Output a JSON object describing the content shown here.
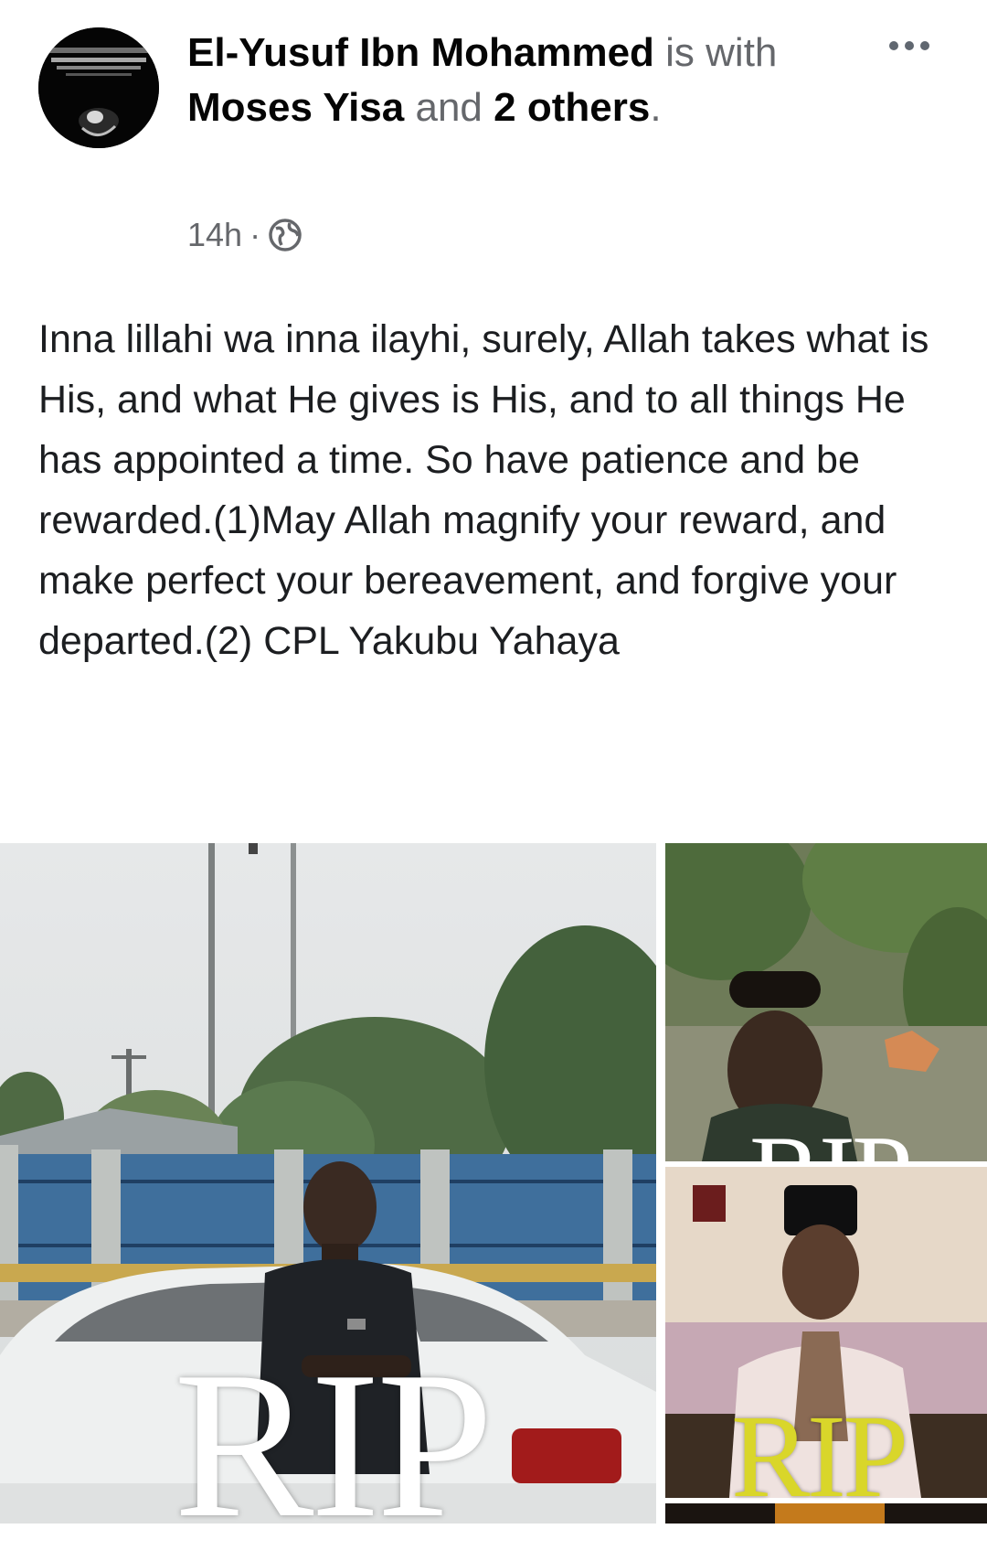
{
  "post": {
    "author": "El-Yusuf Ibn Mohammed",
    "is_text": " is with ",
    "tagged_person": "Moses Yisa",
    "and_text": " and ",
    "others_label": "2 others",
    "period": ".",
    "time": "14h",
    "separator": "·",
    "privacy_icon": "globe-icon",
    "menu_icon": "more-options-icon",
    "body": "Inna lillahi wa inna ilayhi, surely, Allah takes what is His, and what He gives is His, and to all things He has appointed a time. So have patience and be rewarded.(1)May Allah magnify your reward, and make perfect your bereavement, and forgive your departed.(2) CPL Yakubu Yahaya"
  },
  "photos": [
    {
      "name": "photo-main",
      "overlay_text": "RIP"
    },
    {
      "name": "photo-top",
      "overlay_text": "RIP"
    },
    {
      "name": "photo-mid",
      "overlay_text": "RIP"
    },
    {
      "name": "photo-bottom"
    }
  ],
  "colors": {
    "name_text": "#050505",
    "secondary_text": "#65676b",
    "body_text": "#1c1e21",
    "rip_yellow": "#d9d62a"
  }
}
